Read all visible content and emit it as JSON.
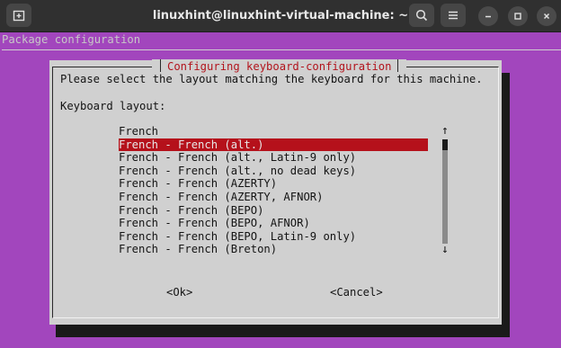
{
  "window": {
    "title": "linuxhint@linuxhint-virtual-machine: ~"
  },
  "terminal": {
    "package_title": "Package configuration",
    "dialog": {
      "title": "Configuring keyboard-configuration",
      "prompt": "Please select the layout matching the keyboard for this machine.",
      "field_label": "Keyboard layout:",
      "options": [
        "French",
        "French - French (alt.)",
        "French - French (alt., Latin-9 only)",
        "French - French (alt., no dead keys)",
        "French - French (AZERTY)",
        "French - French (AZERTY, AFNOR)",
        "French - French (BEPO)",
        "French - French (BEPO, AFNOR)",
        "French - French (BEPO, Latin-9 only)",
        "French - French (Breton)"
      ],
      "selected": "French - French (alt.)",
      "scroll_up": "↑",
      "scroll_down": "↓",
      "ok_label": "<Ok>",
      "cancel_label": "<Cancel>"
    }
  },
  "colors": {
    "terminal_bg": "#a246bd",
    "dialog_bg": "#d0d0d0",
    "highlight": "#b5111b",
    "titlebar_bg": "#303030"
  }
}
